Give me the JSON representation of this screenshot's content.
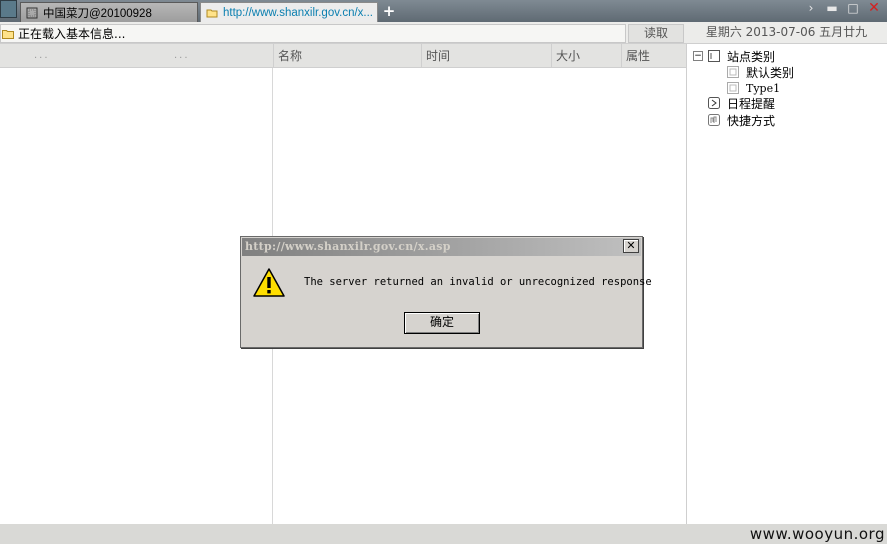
{
  "tabs": [
    {
      "label": "中国菜刀@20100928",
      "icon": "window-icon"
    },
    {
      "label": "http://www.shanxilr.gov.cn/x...",
      "icon": "folder-icon"
    }
  ],
  "tabbar": {
    "add_label": "+",
    "add_icon": "plus-icon"
  },
  "window_controls": {
    "chevron": "›",
    "minimize": "▬",
    "maximize": "□",
    "close": "✕"
  },
  "status": {
    "text": "正在载入基本信息...",
    "icon": "folder-icon"
  },
  "toolbar": {
    "read_label": "读取",
    "date_text": "星期六 2013-07-06 五月廿九"
  },
  "columns": {
    "dots1": "...",
    "dots2": "...",
    "name": "名称",
    "time": "时间",
    "size": "大小",
    "attr": "属性"
  },
  "tree": {
    "root_label": "站点类别",
    "root_expander": "⊟",
    "children": [
      {
        "label": "默认类别"
      },
      {
        "label": "Type1"
      }
    ],
    "schedule_label": "日程提醒",
    "shortcut_label": "快捷方式"
  },
  "dialog": {
    "title": "http://www.shanxilr.gov.cn/x.asp",
    "message": "The server returned an invalid or unrecognized response",
    "ok_label": "确定",
    "close_label": "✕",
    "icon": "warning-icon"
  },
  "footer": {
    "watermark": "www.wooyun.org"
  },
  "colors": {
    "tabbar_bg": "#6f7a83",
    "active_tab_text": "#0a7fb0",
    "dialog_bg": "#d6d3cf",
    "close_red": "#d42020"
  }
}
